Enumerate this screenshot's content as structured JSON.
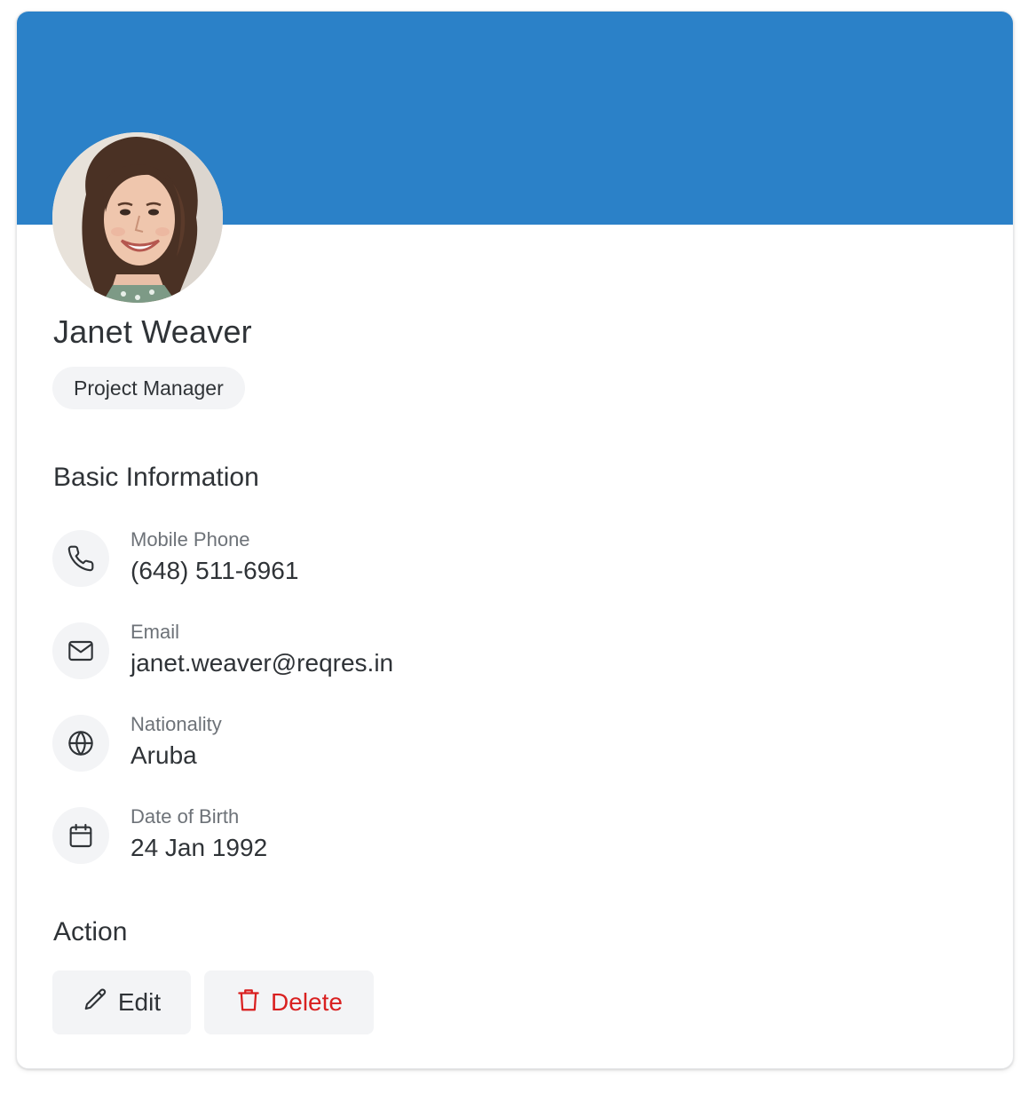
{
  "profile": {
    "name": "Janet Weaver",
    "role": "Project Manager"
  },
  "basic_info": {
    "title": "Basic Information",
    "items": [
      {
        "icon": "phone-icon",
        "label": "Mobile Phone",
        "value": "(648) 511-6961"
      },
      {
        "icon": "mail-icon",
        "label": "Email",
        "value": "janet.weaver@reqres.in"
      },
      {
        "icon": "globe-icon",
        "label": "Nationality",
        "value": "Aruba"
      },
      {
        "icon": "calendar-icon",
        "label": "Date of Birth",
        "value": "24 Jan 1992"
      }
    ]
  },
  "actions": {
    "title": "Action",
    "edit_label": "Edit",
    "delete_label": "Delete"
  },
  "colors": {
    "banner": "#2b81c8",
    "delete": "#d92020",
    "text": "#2f3337",
    "muted": "#6d7278",
    "chip": "#f3f4f6"
  }
}
